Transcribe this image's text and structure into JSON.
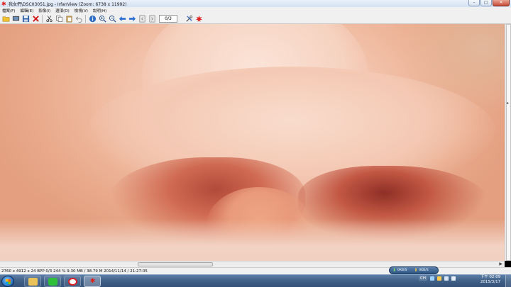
{
  "window": {
    "title": "我女們\\DSC03051.jpg - IrfanView (Zoom: 6738 x 11992)",
    "controls": {
      "minimize": "–",
      "maximize": "□",
      "close": "✕"
    }
  },
  "menu": {
    "items": [
      "檔案(F)",
      "編輯(E)",
      "影像(I)",
      "選項(O)",
      "檢視(V)",
      "說明(H)"
    ]
  },
  "toolbar": {
    "page_value": "0/3"
  },
  "statusbar": {
    "text": "2760 x 4912 x 24 BPP  0/3   244 %   9.30 MB / 38.79 M  2014/11/14 / 21:27:05"
  },
  "scrollbars": {
    "left_arrow": "◀",
    "right_arrow": "▶",
    "vertical_arrow": "▸"
  },
  "downloads": {
    "down_label": "0KB/S",
    "up_label": "0KB/S"
  },
  "taskbar": {
    "apps": [
      {
        "name": "file-explorer",
        "glyph": "📁"
      },
      {
        "name": "line",
        "glyph": "LINE"
      },
      {
        "name": "opera",
        "glyph": "O"
      },
      {
        "name": "irfanview",
        "glyph": "✱"
      }
    ],
    "tray_lang": "CH",
    "clock_time": "下午 02:09",
    "clock_date": "2015/3/17"
  },
  "colors": {
    "accent_irfan": "#e0201b",
    "taskbar": "#3f5f86"
  }
}
